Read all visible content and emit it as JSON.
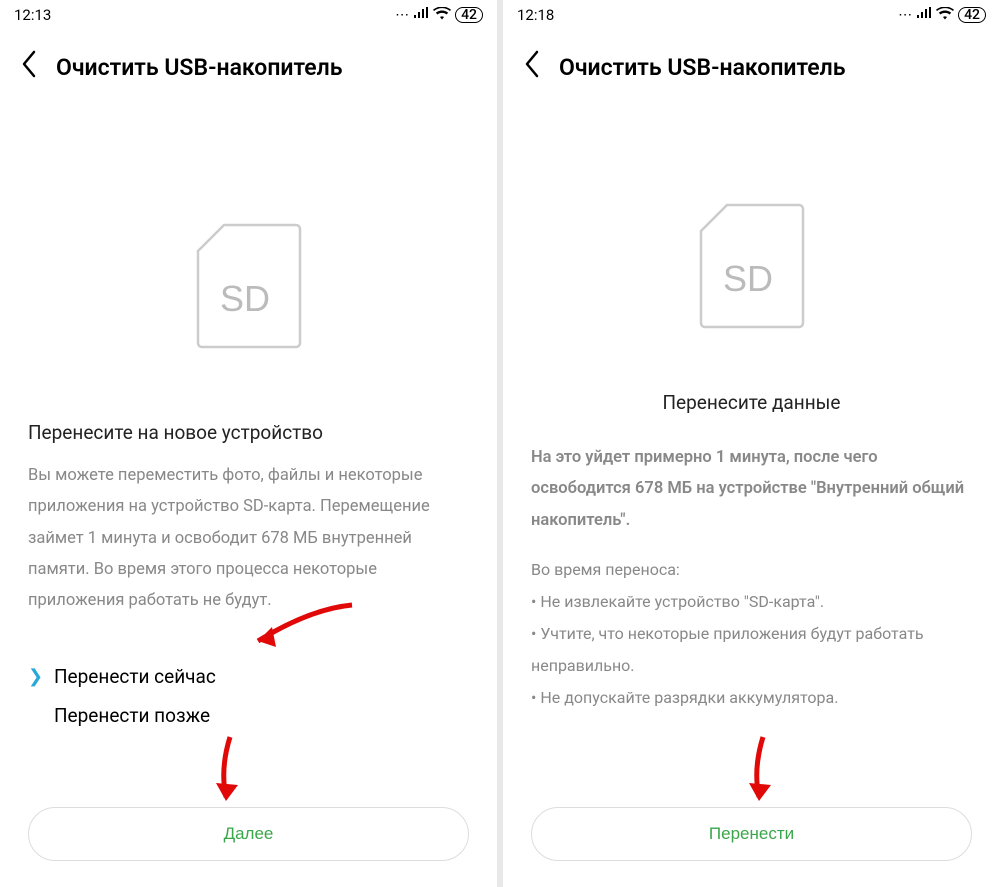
{
  "screens": [
    {
      "statusbar": {
        "time": "12:13",
        "dots": "…",
        "signal": "▮▮▮▮",
        "wifi": "wifi",
        "battery": "42"
      },
      "header": {
        "title": "Очистить USB-накопитель"
      },
      "sd_label": "SD",
      "section_title": "Перенесите на новое устройство",
      "body": "Вы можете переместить фото, файлы и некоторые приложения на устройство SD-карта. Перемещение займет 1 минута и освободит 678 МБ внутренней памяти. Во время этого процесса некоторые приложения работать не будут.",
      "options": {
        "now": "Перенести сейчас",
        "later": "Перенести позже"
      },
      "primary_button": "Далее"
    },
    {
      "statusbar": {
        "time": "12:18",
        "dots": "…",
        "signal": "▮▮▮▮",
        "wifi": "wifi",
        "battery": "42"
      },
      "header": {
        "title": "Очистить USB-накопитель"
      },
      "sd_label": "SD",
      "section_title": "Перенесите данные",
      "body_bold": "На это уйдет примерно 1 минута, после чего освободится 678 МБ на устройстве \"Внутренний общий накопитель\".",
      "notes_heading": "Во время переноса:",
      "notes": [
        "• Не извлекайте устройство \"SD-карта\".",
        "• Учтите, что некоторые приложения будут работать неправильно.",
        "• Не допускайте разрядки аккумулятора."
      ],
      "primary_button": "Перенести"
    }
  ]
}
